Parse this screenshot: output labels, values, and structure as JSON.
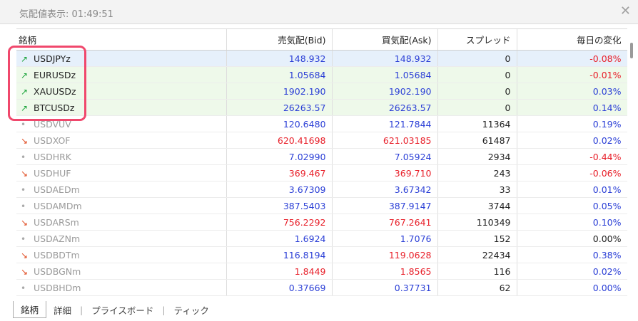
{
  "title": "気配値表示: 01:49:51",
  "columns": [
    "銘柄",
    "売気配(Bid)",
    "買気配(Ask)",
    "スプレッド",
    "毎日の変化"
  ],
  "rows": [
    {
      "symbol": "USDJPYz",
      "dir": "up",
      "bid": "148.932",
      "ask": "148.932",
      "spread": "0",
      "change": "-0.08%",
      "bid_c": "blue",
      "ask_c": "blue",
      "chg_c": "red",
      "style": "sel",
      "sym_c": "dark"
    },
    {
      "symbol": "EURUSDz",
      "dir": "up",
      "bid": "1.05684",
      "ask": "1.05684",
      "spread": "0",
      "change": "-0.01%",
      "bid_c": "blue",
      "ask_c": "blue",
      "chg_c": "red",
      "style": "hl",
      "sym_c": "dark"
    },
    {
      "symbol": "XAUUSDz",
      "dir": "up",
      "bid": "1902.190",
      "ask": "1902.190",
      "spread": "0",
      "change": "0.03%",
      "bid_c": "blue",
      "ask_c": "blue",
      "chg_c": "blue",
      "style": "hl",
      "sym_c": "dark"
    },
    {
      "symbol": "BTCUSDz",
      "dir": "up",
      "bid": "26263.57",
      "ask": "26263.57",
      "spread": "0",
      "change": "0.14%",
      "bid_c": "blue",
      "ask_c": "blue",
      "chg_c": "blue",
      "style": "hl",
      "sym_c": "dark"
    },
    {
      "symbol": "USDVUV",
      "dir": "flat",
      "bid": "120.6480",
      "ask": "121.7844",
      "spread": "11364",
      "change": "0.19%",
      "bid_c": "blue",
      "ask_c": "blue",
      "chg_c": "blue",
      "style": "",
      "sym_c": "gray"
    },
    {
      "symbol": "USDXOF",
      "dir": "down",
      "bid": "620.41698",
      "ask": "621.03185",
      "spread": "61487",
      "change": "0.02%",
      "bid_c": "red",
      "ask_c": "red",
      "chg_c": "blue",
      "style": "",
      "sym_c": "gray"
    },
    {
      "symbol": "USDHRK",
      "dir": "flat",
      "bid": "7.02990",
      "ask": "7.05924",
      "spread": "2934",
      "change": "-0.44%",
      "bid_c": "blue",
      "ask_c": "blue",
      "chg_c": "red",
      "style": "",
      "sym_c": "gray"
    },
    {
      "symbol": "USDHUF",
      "dir": "down",
      "bid": "369.467",
      "ask": "369.710",
      "spread": "243",
      "change": "-0.06%",
      "bid_c": "red",
      "ask_c": "red",
      "chg_c": "red",
      "style": "",
      "sym_c": "gray"
    },
    {
      "symbol": "USDAEDm",
      "dir": "flat",
      "bid": "3.67309",
      "ask": "3.67342",
      "spread": "33",
      "change": "0.01%",
      "bid_c": "blue",
      "ask_c": "blue",
      "chg_c": "blue",
      "style": "",
      "sym_c": "gray"
    },
    {
      "symbol": "USDAMDm",
      "dir": "flat",
      "bid": "387.5403",
      "ask": "387.9147",
      "spread": "3744",
      "change": "0.05%",
      "bid_c": "blue",
      "ask_c": "blue",
      "chg_c": "blue",
      "style": "",
      "sym_c": "gray"
    },
    {
      "symbol": "USDARSm",
      "dir": "down",
      "bid": "756.2292",
      "ask": "767.2641",
      "spread": "110349",
      "change": "0.10%",
      "bid_c": "red",
      "ask_c": "red",
      "chg_c": "blue",
      "style": "",
      "sym_c": "gray"
    },
    {
      "symbol": "USDAZNm",
      "dir": "flat",
      "bid": "1.6924",
      "ask": "1.7076",
      "spread": "152",
      "change": "0.00%",
      "bid_c": "blue",
      "ask_c": "blue",
      "chg_c": "dark",
      "style": "",
      "sym_c": "gray"
    },
    {
      "symbol": "USDBDTm",
      "dir": "down",
      "bid": "116.8194",
      "ask": "119.0628",
      "spread": "22434",
      "change": "0.38%",
      "bid_c": "blue",
      "ask_c": "red",
      "chg_c": "blue",
      "style": "",
      "sym_c": "gray"
    },
    {
      "symbol": "USDBGNm",
      "dir": "down",
      "bid": "1.8449",
      "ask": "1.8565",
      "spread": "116",
      "change": "0.02%",
      "bid_c": "red",
      "ask_c": "red",
      "chg_c": "blue",
      "style": "",
      "sym_c": "gray"
    },
    {
      "symbol": "USDBHDm",
      "dir": "flat",
      "bid": "0.37669",
      "ask": "0.37731",
      "spread": "62",
      "change": "0.00%",
      "bid_c": "blue",
      "ask_c": "blue",
      "chg_c": "blue",
      "style": "",
      "sym_c": "gray"
    }
  ],
  "arrows": {
    "up": "↗",
    "down": "↘",
    "flat": "•"
  },
  "tabs": [
    "銘柄",
    "詳細",
    "プライスボード",
    "ティック"
  ],
  "tab_separator": "|",
  "close_glyph": "✕",
  "colors": {
    "highlight_border": "#f0486c",
    "positive": "#2b3fd6",
    "negative": "#e8202a",
    "up_arrow": "#1aa33a",
    "down_arrow": "#e04a1f"
  }
}
